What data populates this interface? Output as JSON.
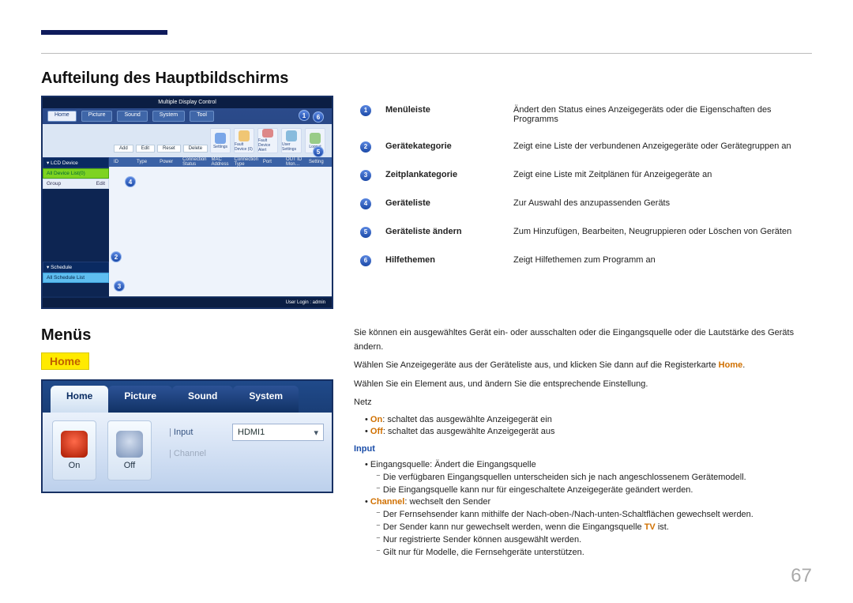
{
  "heading_main": "Aufteilung des Hauptbildschirms",
  "heading_menus": "Menüs",
  "home_tag": "Home",
  "page_number": "67",
  "legend": [
    {
      "n": "1",
      "label": "Menüleiste",
      "desc": "Ändert den Status eines Anzeigegeräts oder die Eigenschaften des Programms"
    },
    {
      "n": "2",
      "label": "Gerätekategorie",
      "desc": "Zeigt eine Liste der verbundenen Anzeigegeräte oder Gerätegruppen an"
    },
    {
      "n": "3",
      "label": "Zeitplankategorie",
      "desc": "Zeigt eine Liste mit Zeitplänen für Anzeigegeräte an"
    },
    {
      "n": "4",
      "label": "Geräteliste",
      "desc": "Zur Auswahl des anzupassenden Geräts"
    },
    {
      "n": "5",
      "label": "Geräteliste ändern",
      "desc": "Zum Hinzufügen, Bearbeiten, Neugruppieren oder Löschen von Geräten"
    },
    {
      "n": "6",
      "label": "Hilfethemen",
      "desc": "Zeigt Hilfethemen zum Programm an"
    }
  ],
  "mock1": {
    "title": "Multiple Display Control",
    "tabs": [
      "Home",
      "Picture",
      "Sound",
      "System",
      "Tool"
    ],
    "toolbtns": [
      {
        "label": "Settings"
      },
      {
        "label": "Fault Device (0)"
      },
      {
        "label": "Fault Device Alert"
      },
      {
        "label": "User Settings"
      },
      {
        "label": "Logout"
      }
    ],
    "side_hdr": "▾ LCD Device",
    "side_sel": "All Device List(0)",
    "side_group": "Group",
    "side_edit": "Edit",
    "side_sched": "▾ Schedule",
    "side_schedlist": "All Schedule List",
    "mainbtns": [
      "Add",
      "Edit",
      "Reset",
      "Delete"
    ],
    "tblhdrs": [
      "ID",
      "Type",
      "Power",
      "Connection Status",
      "MAC Address",
      "Connection Type",
      "Port",
      "OUT ID Mon…",
      "Setting"
    ],
    "footer": "User Login : admin"
  },
  "mock2": {
    "tabs": [
      "Home",
      "Picture",
      "Sound",
      "System"
    ],
    "on": "On",
    "off": "Off",
    "input_label": "Input",
    "input_bar": "|",
    "input_value": "HDMI1",
    "channel_label": "Channel",
    "channel_bar": "|"
  },
  "rtxt": {
    "p1": "Sie können ein ausgewähltes Gerät ein- oder ausschalten oder die Eingangsquelle oder die Lautstärke des Geräts ändern.",
    "p2_a": "Wählen Sie Anzeigegeräte aus der Geräteliste aus, und klicken Sie dann auf die Registerkarte ",
    "p2_home": "Home",
    "p2_b": ".",
    "p3": "Wählen Sie ein Element aus, und ändern Sie die entsprechende Einstellung.",
    "netz": "Netz",
    "on_word": "On",
    "on_desc": ": schaltet das ausgewählte Anzeigegerät ein",
    "off_word": "Off",
    "off_desc": ": schaltet das ausgewählte Anzeigegerät aus",
    "input_hdr": "Input",
    "inp1": "Eingangsquelle: Ändert die Eingangsquelle",
    "inp1a": "Die verfügbaren Eingangsquellen unterscheiden sich je nach angeschlossenem Gerätemodell.",
    "inp1b": "Die Eingangsquelle kann nur für eingeschaltete Anzeigegeräte geändert werden.",
    "ch_word": "Channel",
    "ch_desc": ": wechselt den Sender",
    "ch_a": "Der Fernsehsender kann mithilfe der Nach-oben-/Nach-unten-Schaltflächen gewechselt werden.",
    "ch_b_a": "Der Sender kann nur gewechselt werden, wenn die Eingangsquelle ",
    "ch_b_tv": "TV",
    "ch_b_c": " ist.",
    "ch_c": "Nur registrierte Sender können ausgewählt werden.",
    "ch_d": "Gilt nur für Modelle, die Fernsehgeräte unterstützen."
  }
}
